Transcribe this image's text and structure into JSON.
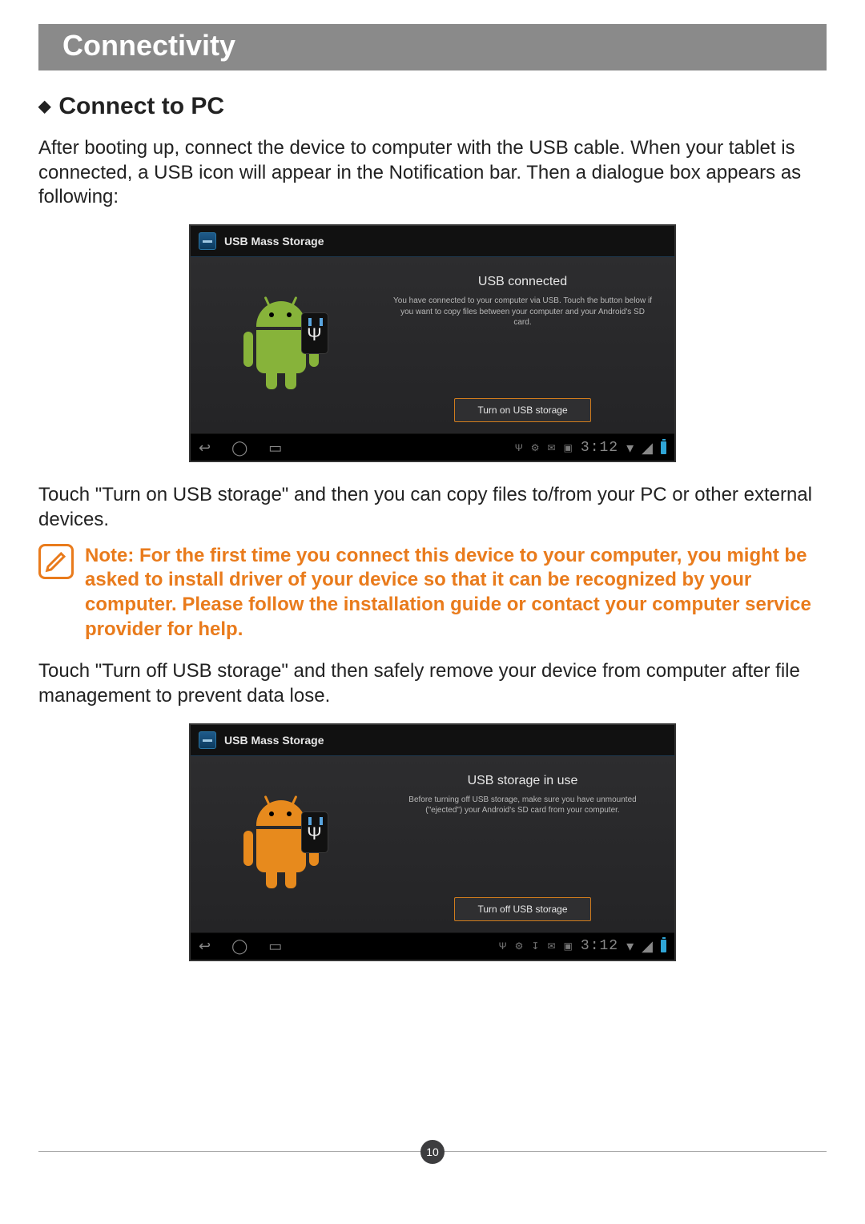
{
  "section_title": "Connectivity",
  "subhead": "Connect to PC",
  "para1": "After booting up, connect the device to computer with the USB cable. When your tablet is connected, a USB icon will appear in the Notification bar. Then a dialogue box appears as following:",
  "para2": "Touch \"Turn on USB storage\" and then you can copy files to/from your PC or other external devices.",
  "note_text": "Note: For the first time you connect this device to your computer, you might be asked to install driver of your device so that it can be recognized by your computer. Please follow the installation guide or contact your computer service provider for help.",
  "para3": "Touch \"Turn off USB storage\" and then safely remove your device from computer after file management to prevent data lose.",
  "shot1": {
    "titlebar": "USB Mass Storage",
    "heading": "USB connected",
    "desc": "You have connected to your computer via USB. Touch the button below if you want to copy files between your computer and your Android's SD card.",
    "button": "Turn on USB storage",
    "clock": "3:12",
    "usb_symbol": "Ψ"
  },
  "shot2": {
    "titlebar": "USB Mass Storage",
    "heading": "USB storage in use",
    "desc": "Before turning off USB storage, make sure you have unmounted (\"ejected\") your Android's SD card from your computer.",
    "button": "Turn off USB storage",
    "clock": "3:12",
    "usb_symbol": "Ψ"
  },
  "nav_glyphs": {
    "back": "↩",
    "home": "◯",
    "recent": "▭"
  },
  "page_number": "10"
}
